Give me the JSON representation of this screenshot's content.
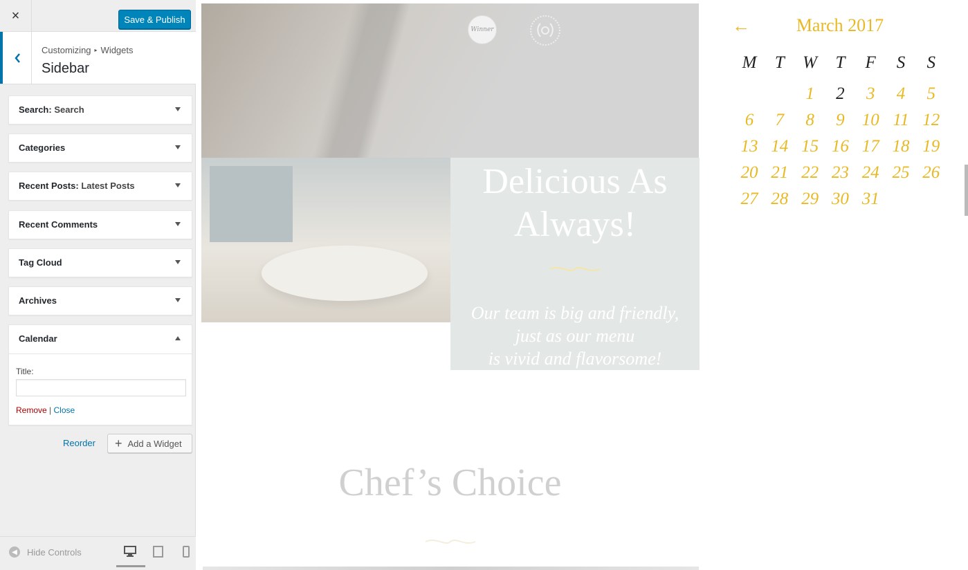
{
  "header": {
    "close_icon": "×",
    "publish_label": "Save & Publish",
    "colors": {
      "publish_bg": "#0085ba",
      "accent": "#0073aa",
      "link": "#0073aa",
      "remove": "#aa0000"
    }
  },
  "section": {
    "breadcrumb": [
      "Customizing",
      "Widgets"
    ],
    "title": "Sidebar",
    "back_icon": "chevron-left-icon"
  },
  "widgets": [
    {
      "title": "Search",
      "subtitle": "Search",
      "expanded": false
    },
    {
      "title": "Categories",
      "subtitle": "",
      "expanded": false
    },
    {
      "title": "Recent Posts",
      "subtitle": "Latest Posts",
      "expanded": false
    },
    {
      "title": "Recent Comments",
      "subtitle": "",
      "expanded": false
    },
    {
      "title": "Tag Cloud",
      "subtitle": "",
      "expanded": false
    },
    {
      "title": "Archives",
      "subtitle": "",
      "expanded": false
    },
    {
      "title": "Calendar",
      "subtitle": "",
      "expanded": true
    }
  ],
  "calendar_form": {
    "title_label": "Title:",
    "title_value": "",
    "remove_label": "Remove",
    "separator": "|",
    "close_label": "Close"
  },
  "actions": {
    "reorder_label": "Reorder",
    "add_widget_label": "Add a Widget",
    "add_icon": "+"
  },
  "footer": {
    "hide_controls_label": "Hide Controls",
    "devices": [
      "desktop-icon",
      "tablet-icon",
      "mobile-icon"
    ]
  },
  "preview": {
    "badge_1": "Winner",
    "headline": "Delicious As Always!",
    "tagline_lines": [
      "Our team is big and friendly,",
      "just as our menu",
      "is vivid and flavorsome!"
    ],
    "section_title": "Chef’s Choice",
    "calendar": {
      "caption": "March 2017",
      "prev_icon": "←",
      "weekdays": [
        "M",
        "T",
        "W",
        "T",
        "F",
        "S",
        "S"
      ],
      "first_weekday_index": 2,
      "days_in_month": 31,
      "today": 2,
      "colors": {
        "day": "#e8b923",
        "heading": "#222222"
      }
    }
  }
}
